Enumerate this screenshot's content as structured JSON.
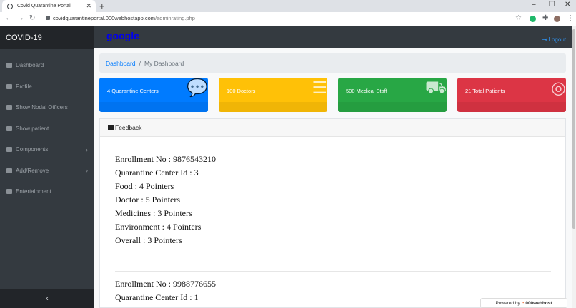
{
  "browser": {
    "tab_title": "Covid Quarantine Portal",
    "url_host": "covidquarantineportal.000webhostapp.com",
    "url_path": "/adminrating.php"
  },
  "sidebar": {
    "brand": "COVID-19",
    "items": [
      {
        "label": "Dashboard",
        "icon": "dashboard-icon"
      },
      {
        "label": "Profile",
        "icon": "table-icon"
      },
      {
        "label": "Show Nodal Officers",
        "icon": "table-icon"
      },
      {
        "label": "Show patient",
        "icon": "table-icon"
      },
      {
        "label": "Components",
        "icon": "wrench-icon",
        "submenu": true
      },
      {
        "label": "Add/Remove",
        "icon": "file-icon",
        "submenu": true
      },
      {
        "label": "Entertainment",
        "icon": "link-icon"
      }
    ],
    "collapse_glyph": "‹"
  },
  "topnav": {
    "logo": "google",
    "logout": "Logout"
  },
  "breadcrumb": {
    "home": "Dashboard",
    "separator": "/",
    "current": "My Dashboard"
  },
  "cards": [
    {
      "label": "4 Quarantine Centers",
      "color": "#007bff",
      "icon": "comments-icon"
    },
    {
      "label": "100 Doctors",
      "color": "#ffc107",
      "icon": "list-icon"
    },
    {
      "label": "500 Medical Staff",
      "color": "#28a745",
      "icon": "cart-icon"
    },
    {
      "label": "21 Total Patients",
      "color": "#dc3545",
      "icon": "lifebuoy-icon"
    }
  ],
  "feedback": {
    "title": "Feedback",
    "records": [
      {
        "enrollment": "Enrollment No : 9876543210",
        "center": "Quarantine Center Id : 3",
        "food": "Food : 4 Pointers",
        "doctor": "Doctor : 5 Pointers",
        "medicines": "Medicines : 3 Pointers",
        "environment": "Environment : 4 Pointers",
        "overall": "Overall : 3 Pointers"
      },
      {
        "enrollment": "Enrollment No : 9988776655",
        "center": "Quarantine Center Id : 1"
      }
    ]
  },
  "footer": {
    "powered_by": "Powered by",
    "host": "000webhost"
  }
}
